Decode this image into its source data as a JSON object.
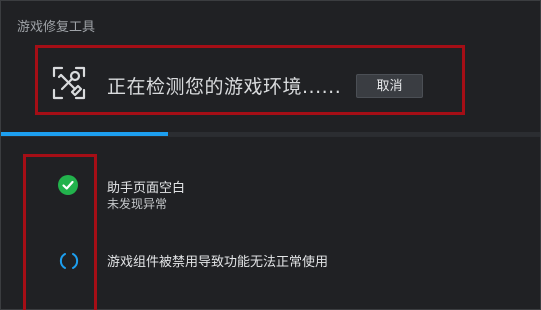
{
  "window": {
    "title": "游戏修复工具"
  },
  "header": {
    "status_text": "正在检测您的游戏环境......",
    "cancel_label": "取消",
    "icon": "wrench-screwdriver-icon"
  },
  "progress": {
    "fraction": 0.31,
    "color": "#1d9ff0"
  },
  "checks": [
    {
      "title": "助手页面空白",
      "subtitle": "未发现异常",
      "state": "passed",
      "icon": "check-circle-icon"
    },
    {
      "title": "游戏组件被禁用导致功能无法正常使用",
      "state": "checking",
      "icon": "loading-spinner-icon"
    }
  ],
  "colors": {
    "highlight": "#a50e16",
    "success": "#22b24c",
    "spinner": "#1d9ff0"
  }
}
